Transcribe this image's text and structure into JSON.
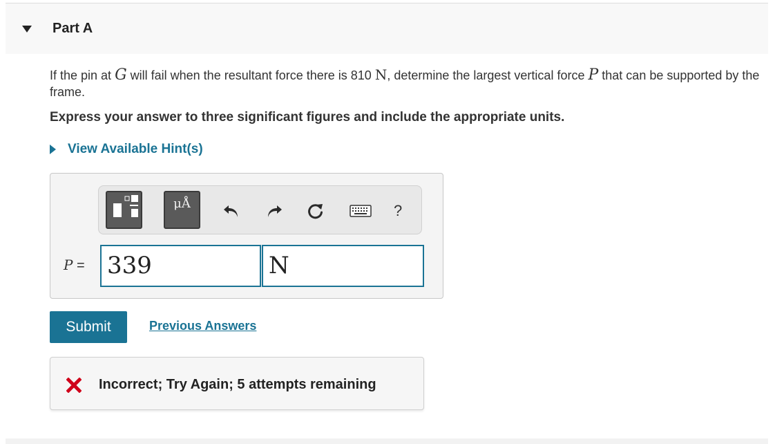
{
  "part": {
    "title": "Part A"
  },
  "question": {
    "seg1": "If the pin at ",
    "var_g": "G",
    "seg2": " will fail when the resultant force there is 810 ",
    "unit_n": "N",
    "seg3": ", determine the largest vertical force ",
    "var_p": "P",
    "seg4": " that can be supported by the frame."
  },
  "instruction": "Express your answer to three significant figures and include the appropriate units.",
  "hints": {
    "label": "View Available Hint(s)"
  },
  "toolbar": {
    "units_glyph": "μÅ",
    "help_label": "?",
    "icons": [
      "templates-icon",
      "units-icon",
      "undo-icon",
      "redo-icon",
      "reset-icon",
      "keyboard-icon",
      "help-icon"
    ]
  },
  "answer": {
    "variable": "P",
    "equals": "=",
    "value": "339",
    "unit": "N"
  },
  "actions": {
    "submit_label": "Submit",
    "previous_answers_label": "Previous Answers"
  },
  "feedback": {
    "text": "Incorrect; Try Again; 5 attempts remaining"
  },
  "colors": {
    "accent": "#1a7394",
    "error": "#d0021b"
  }
}
